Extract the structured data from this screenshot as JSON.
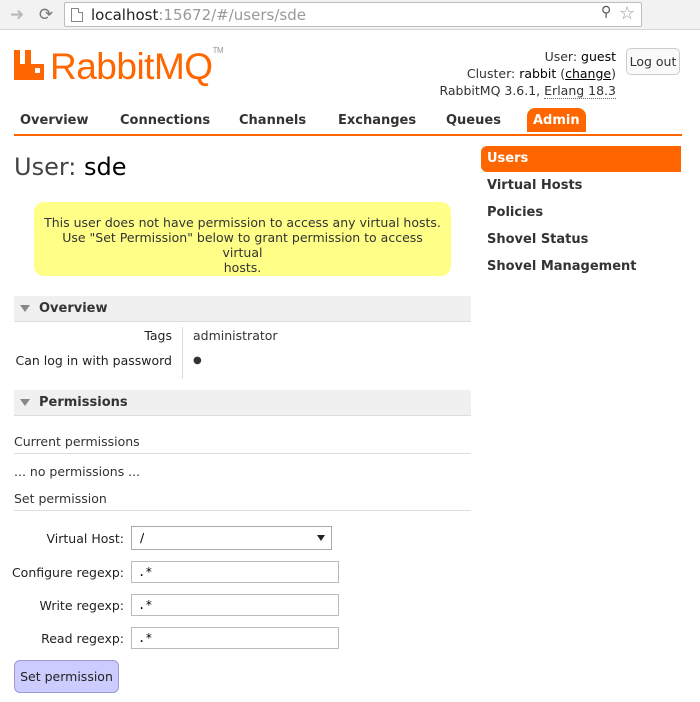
{
  "browser": {
    "url_host": "localhost",
    "url_rest": ":15672/#/users/sde"
  },
  "header": {
    "logo_text": "RabbitMQ",
    "logo_tm": "TM",
    "user_label": "User:",
    "user_name": "guest",
    "cluster_label": "Cluster:",
    "cluster_name": "rabbit",
    "cluster_change": "change",
    "version": "RabbitMQ 3.6.1,",
    "erlang": "Erlang 18.3",
    "logout": "Log out"
  },
  "tabs": [
    "Overview",
    "Connections",
    "Channels",
    "Exchanges",
    "Queues",
    "Admin"
  ],
  "active_tab": "Admin",
  "page": {
    "title_label": "User:",
    "title_name": "sde",
    "warning_line1": "This user does not have permission to access any virtual hosts.",
    "warning_line2": "Use \"Set Permission\" below to grant permission to access virtual",
    "warning_line3": "hosts."
  },
  "overview": {
    "title": "Overview",
    "tags_label": "Tags",
    "tags_value": "administrator",
    "login_label": "Can log in with password",
    "login_value": "●"
  },
  "permissions": {
    "title": "Permissions",
    "current_label": "Current permissions",
    "none_text": "... no permissions ...",
    "set_label": "Set permission",
    "vhost_label": "Virtual Host:",
    "vhost_value": "/",
    "configure_label": "Configure regexp:",
    "configure_value": ".*",
    "write_label": "Write regexp:",
    "write_value": ".*",
    "read_label": "Read regexp:",
    "read_value": ".*",
    "submit": "Set permission"
  },
  "sidemenu": [
    "Users",
    "Virtual Hosts",
    "Policies",
    "Shovel Status",
    "Shovel Management"
  ],
  "colors": {
    "brand": "#ff6600",
    "warning_bg": "#ffff88",
    "button_bg": "#ccccff"
  }
}
